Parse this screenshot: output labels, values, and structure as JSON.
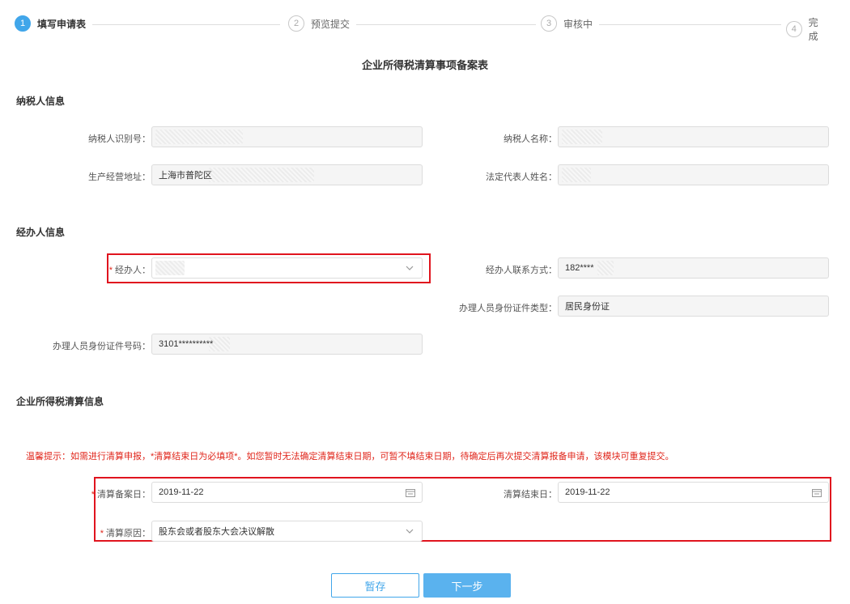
{
  "steps": [
    {
      "num": "1",
      "label": "填写申请表"
    },
    {
      "num": "2",
      "label": "预览提交"
    },
    {
      "num": "3",
      "label": "审核中"
    },
    {
      "num": "4",
      "label": "完成"
    }
  ],
  "active_step": 1,
  "form_title": "企业所得税清算事项备案表",
  "taxpayer": {
    "section_title": "纳税人信息",
    "id_label": "纳税人识别号：",
    "id_value": "",
    "name_label": "纳税人名称：",
    "name_value": "",
    "address_label": "生产经营地址：",
    "address_value": "上海市普陀区",
    "rep_label": "法定代表人姓名：",
    "rep_value": ""
  },
  "agent": {
    "section_title": "经办人信息",
    "agent_label": "经办人：",
    "agent_value": "",
    "contact_label": "经办人联系方式：",
    "contact_value": "182****",
    "idtype_label": "办理人员身份证件类型：",
    "idtype_value": "居民身份证",
    "idnum_label": "办理人员身份证件号码：",
    "idnum_value": "3101**********"
  },
  "liquidation": {
    "section_title": "企业所得税清算信息",
    "tip": "温馨提示：如需进行清算申报，*清算结束日为必填项*。如您暂时无法确定清算结束日期，可暂不填结束日期，待确定后再次提交清算报备申请，该模块可重复提交。",
    "filing_date_label": "清算备案日：",
    "filing_date_value": "2019-11-22",
    "end_date_label": "清算结束日：",
    "end_date_value": "2019-11-22",
    "reason_label": "清算原因：",
    "reason_value": "股东会或者股东大会决议解散"
  },
  "required_mark": "*",
  "buttons": {
    "save": "暂存",
    "next": "下一步"
  },
  "colors": {
    "accent": "#41a6ea",
    "highlight": "#e0141e",
    "warning_text": "#e0261b"
  }
}
